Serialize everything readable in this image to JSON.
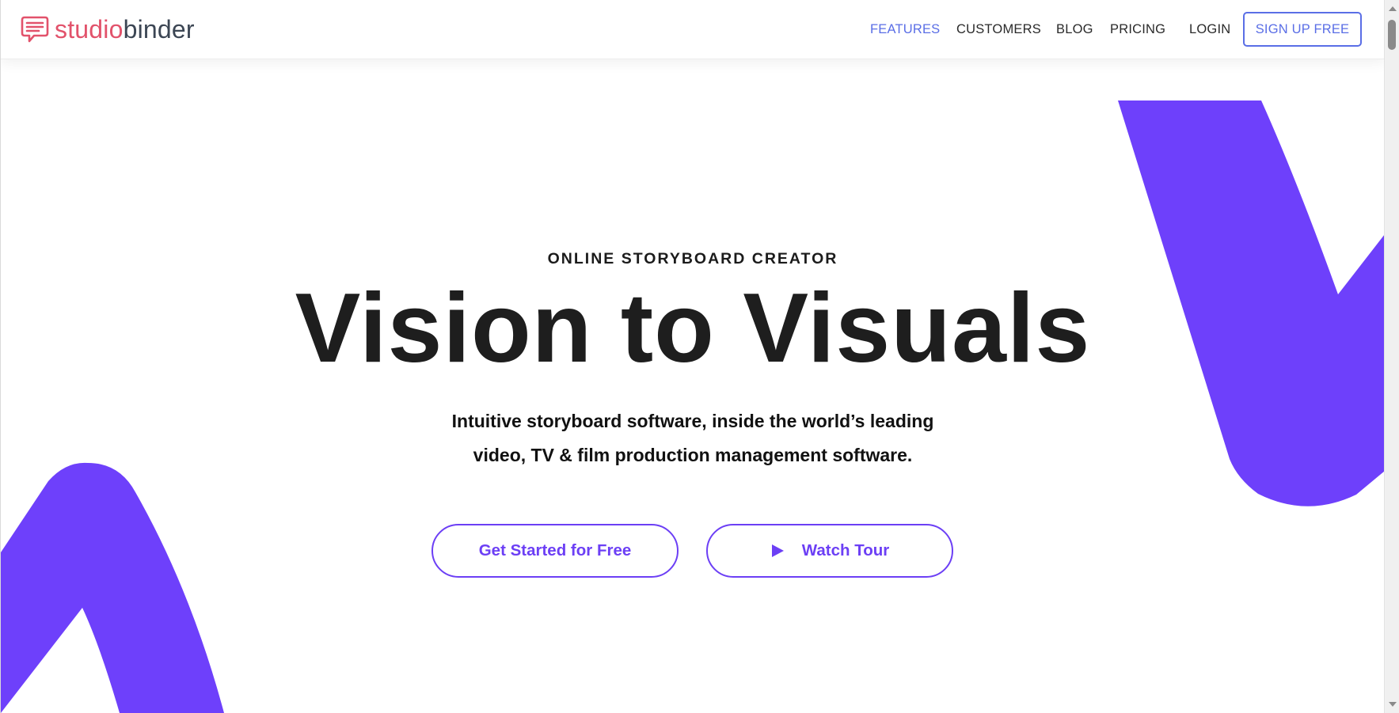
{
  "brand": {
    "logo_part_1": "studio",
    "logo_part_2": "binder",
    "primary_color": "#e2526b",
    "secondary_color": "#3c4654",
    "logo_icon": "speech-bubble-icon"
  },
  "nav": {
    "features": "FEATURES",
    "customers": "CUSTOMERS",
    "blog": "BLOG",
    "pricing": "PRICING",
    "login": "LOGIN",
    "signup": "SIGN UP FREE",
    "active_color": "#5a6ee6"
  },
  "hero": {
    "eyebrow": "ONLINE STORYBOARD CREATOR",
    "headline": "Vision to Visuals",
    "subtitle_line_1": "Intuitive storyboard software, inside the world’s leading",
    "subtitle_line_2": "video, TV & film production management software.",
    "cta_primary": "Get Started for Free",
    "cta_secondary": "Watch Tour",
    "cta_secondary_icon": "play-icon",
    "accent_color": "#6c3ff5",
    "shape_color": "#6e40fb"
  },
  "scrollbar": {
    "up_icon": "scroll-up-arrow-icon",
    "down_icon": "scroll-down-arrow-icon"
  }
}
